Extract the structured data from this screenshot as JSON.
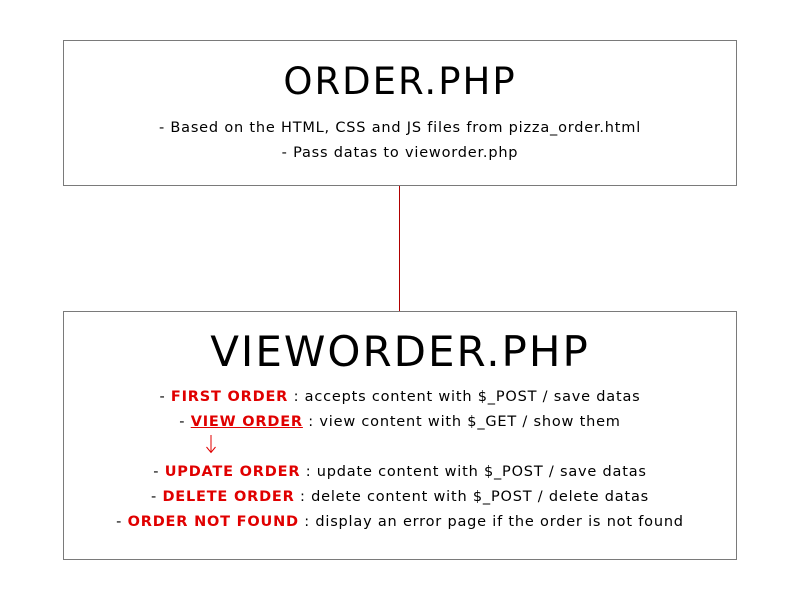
{
  "colors": {
    "accent": "#e00000",
    "connector": "#b00000",
    "border": "#7a7a7a"
  },
  "order_box": {
    "title": "ORDER.PHP",
    "lines": [
      "- Based on the HTML, CSS and JS files from pizza_order.html",
      "- Pass datas to vieworder.php"
    ]
  },
  "vieworder_box": {
    "title": "VIEWORDER.PHP",
    "items": [
      {
        "prefix": "- ",
        "keyword": "FIRST ORDER",
        "rest": " : accepts content with $_POST / save datas"
      },
      {
        "prefix": "- ",
        "keyword": "VIEW ORDER",
        "rest": " : view content with $_GET / show them"
      },
      {
        "prefix": "- ",
        "keyword": "UPDATE ORDER",
        "rest": " : update content with $_POST / save datas"
      },
      {
        "prefix": "- ",
        "keyword": "DELETE ORDER",
        "rest": " : delete content with $_POST / delete datas"
      },
      {
        "prefix": "- ",
        "keyword": "ORDER NOT FOUND",
        "rest": " : display an error page if the order is not found"
      }
    ]
  }
}
